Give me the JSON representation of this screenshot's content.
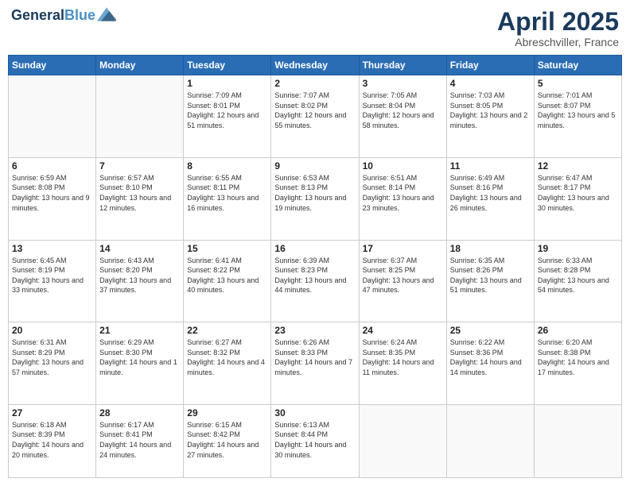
{
  "header": {
    "logo_line1": "General",
    "logo_line2": "Blue",
    "month_year": "April 2025",
    "location": "Abreschviller, France"
  },
  "weekdays": [
    "Sunday",
    "Monday",
    "Tuesday",
    "Wednesday",
    "Thursday",
    "Friday",
    "Saturday"
  ],
  "weeks": [
    [
      {
        "day": "",
        "info": ""
      },
      {
        "day": "",
        "info": ""
      },
      {
        "day": "1",
        "info": "Sunrise: 7:09 AM\nSunset: 8:01 PM\nDaylight: 12 hours and 51 minutes."
      },
      {
        "day": "2",
        "info": "Sunrise: 7:07 AM\nSunset: 8:02 PM\nDaylight: 12 hours and 55 minutes."
      },
      {
        "day": "3",
        "info": "Sunrise: 7:05 AM\nSunset: 8:04 PM\nDaylight: 12 hours and 58 minutes."
      },
      {
        "day": "4",
        "info": "Sunrise: 7:03 AM\nSunset: 8:05 PM\nDaylight: 13 hours and 2 minutes."
      },
      {
        "day": "5",
        "info": "Sunrise: 7:01 AM\nSunset: 8:07 PM\nDaylight: 13 hours and 5 minutes."
      }
    ],
    [
      {
        "day": "6",
        "info": "Sunrise: 6:59 AM\nSunset: 8:08 PM\nDaylight: 13 hours and 9 minutes."
      },
      {
        "day": "7",
        "info": "Sunrise: 6:57 AM\nSunset: 8:10 PM\nDaylight: 13 hours and 12 minutes."
      },
      {
        "day": "8",
        "info": "Sunrise: 6:55 AM\nSunset: 8:11 PM\nDaylight: 13 hours and 16 minutes."
      },
      {
        "day": "9",
        "info": "Sunrise: 6:53 AM\nSunset: 8:13 PM\nDaylight: 13 hours and 19 minutes."
      },
      {
        "day": "10",
        "info": "Sunrise: 6:51 AM\nSunset: 8:14 PM\nDaylight: 13 hours and 23 minutes."
      },
      {
        "day": "11",
        "info": "Sunrise: 6:49 AM\nSunset: 8:16 PM\nDaylight: 13 hours and 26 minutes."
      },
      {
        "day": "12",
        "info": "Sunrise: 6:47 AM\nSunset: 8:17 PM\nDaylight: 13 hours and 30 minutes."
      }
    ],
    [
      {
        "day": "13",
        "info": "Sunrise: 6:45 AM\nSunset: 8:19 PM\nDaylight: 13 hours and 33 minutes."
      },
      {
        "day": "14",
        "info": "Sunrise: 6:43 AM\nSunset: 8:20 PM\nDaylight: 13 hours and 37 minutes."
      },
      {
        "day": "15",
        "info": "Sunrise: 6:41 AM\nSunset: 8:22 PM\nDaylight: 13 hours and 40 minutes."
      },
      {
        "day": "16",
        "info": "Sunrise: 6:39 AM\nSunset: 8:23 PM\nDaylight: 13 hours and 44 minutes."
      },
      {
        "day": "17",
        "info": "Sunrise: 6:37 AM\nSunset: 8:25 PM\nDaylight: 13 hours and 47 minutes."
      },
      {
        "day": "18",
        "info": "Sunrise: 6:35 AM\nSunset: 8:26 PM\nDaylight: 13 hours and 51 minutes."
      },
      {
        "day": "19",
        "info": "Sunrise: 6:33 AM\nSunset: 8:28 PM\nDaylight: 13 hours and 54 minutes."
      }
    ],
    [
      {
        "day": "20",
        "info": "Sunrise: 6:31 AM\nSunset: 8:29 PM\nDaylight: 13 hours and 57 minutes."
      },
      {
        "day": "21",
        "info": "Sunrise: 6:29 AM\nSunset: 8:30 PM\nDaylight: 14 hours and 1 minute."
      },
      {
        "day": "22",
        "info": "Sunrise: 6:27 AM\nSunset: 8:32 PM\nDaylight: 14 hours and 4 minutes."
      },
      {
        "day": "23",
        "info": "Sunrise: 6:26 AM\nSunset: 8:33 PM\nDaylight: 14 hours and 7 minutes."
      },
      {
        "day": "24",
        "info": "Sunrise: 6:24 AM\nSunset: 8:35 PM\nDaylight: 14 hours and 11 minutes."
      },
      {
        "day": "25",
        "info": "Sunrise: 6:22 AM\nSunset: 8:36 PM\nDaylight: 14 hours and 14 minutes."
      },
      {
        "day": "26",
        "info": "Sunrise: 6:20 AM\nSunset: 8:38 PM\nDaylight: 14 hours and 17 minutes."
      }
    ],
    [
      {
        "day": "27",
        "info": "Sunrise: 6:18 AM\nSunset: 8:39 PM\nDaylight: 14 hours and 20 minutes."
      },
      {
        "day": "28",
        "info": "Sunrise: 6:17 AM\nSunset: 8:41 PM\nDaylight: 14 hours and 24 minutes."
      },
      {
        "day": "29",
        "info": "Sunrise: 6:15 AM\nSunset: 8:42 PM\nDaylight: 14 hours and 27 minutes."
      },
      {
        "day": "30",
        "info": "Sunrise: 6:13 AM\nSunset: 8:44 PM\nDaylight: 14 hours and 30 minutes."
      },
      {
        "day": "",
        "info": ""
      },
      {
        "day": "",
        "info": ""
      },
      {
        "day": "",
        "info": ""
      }
    ]
  ]
}
